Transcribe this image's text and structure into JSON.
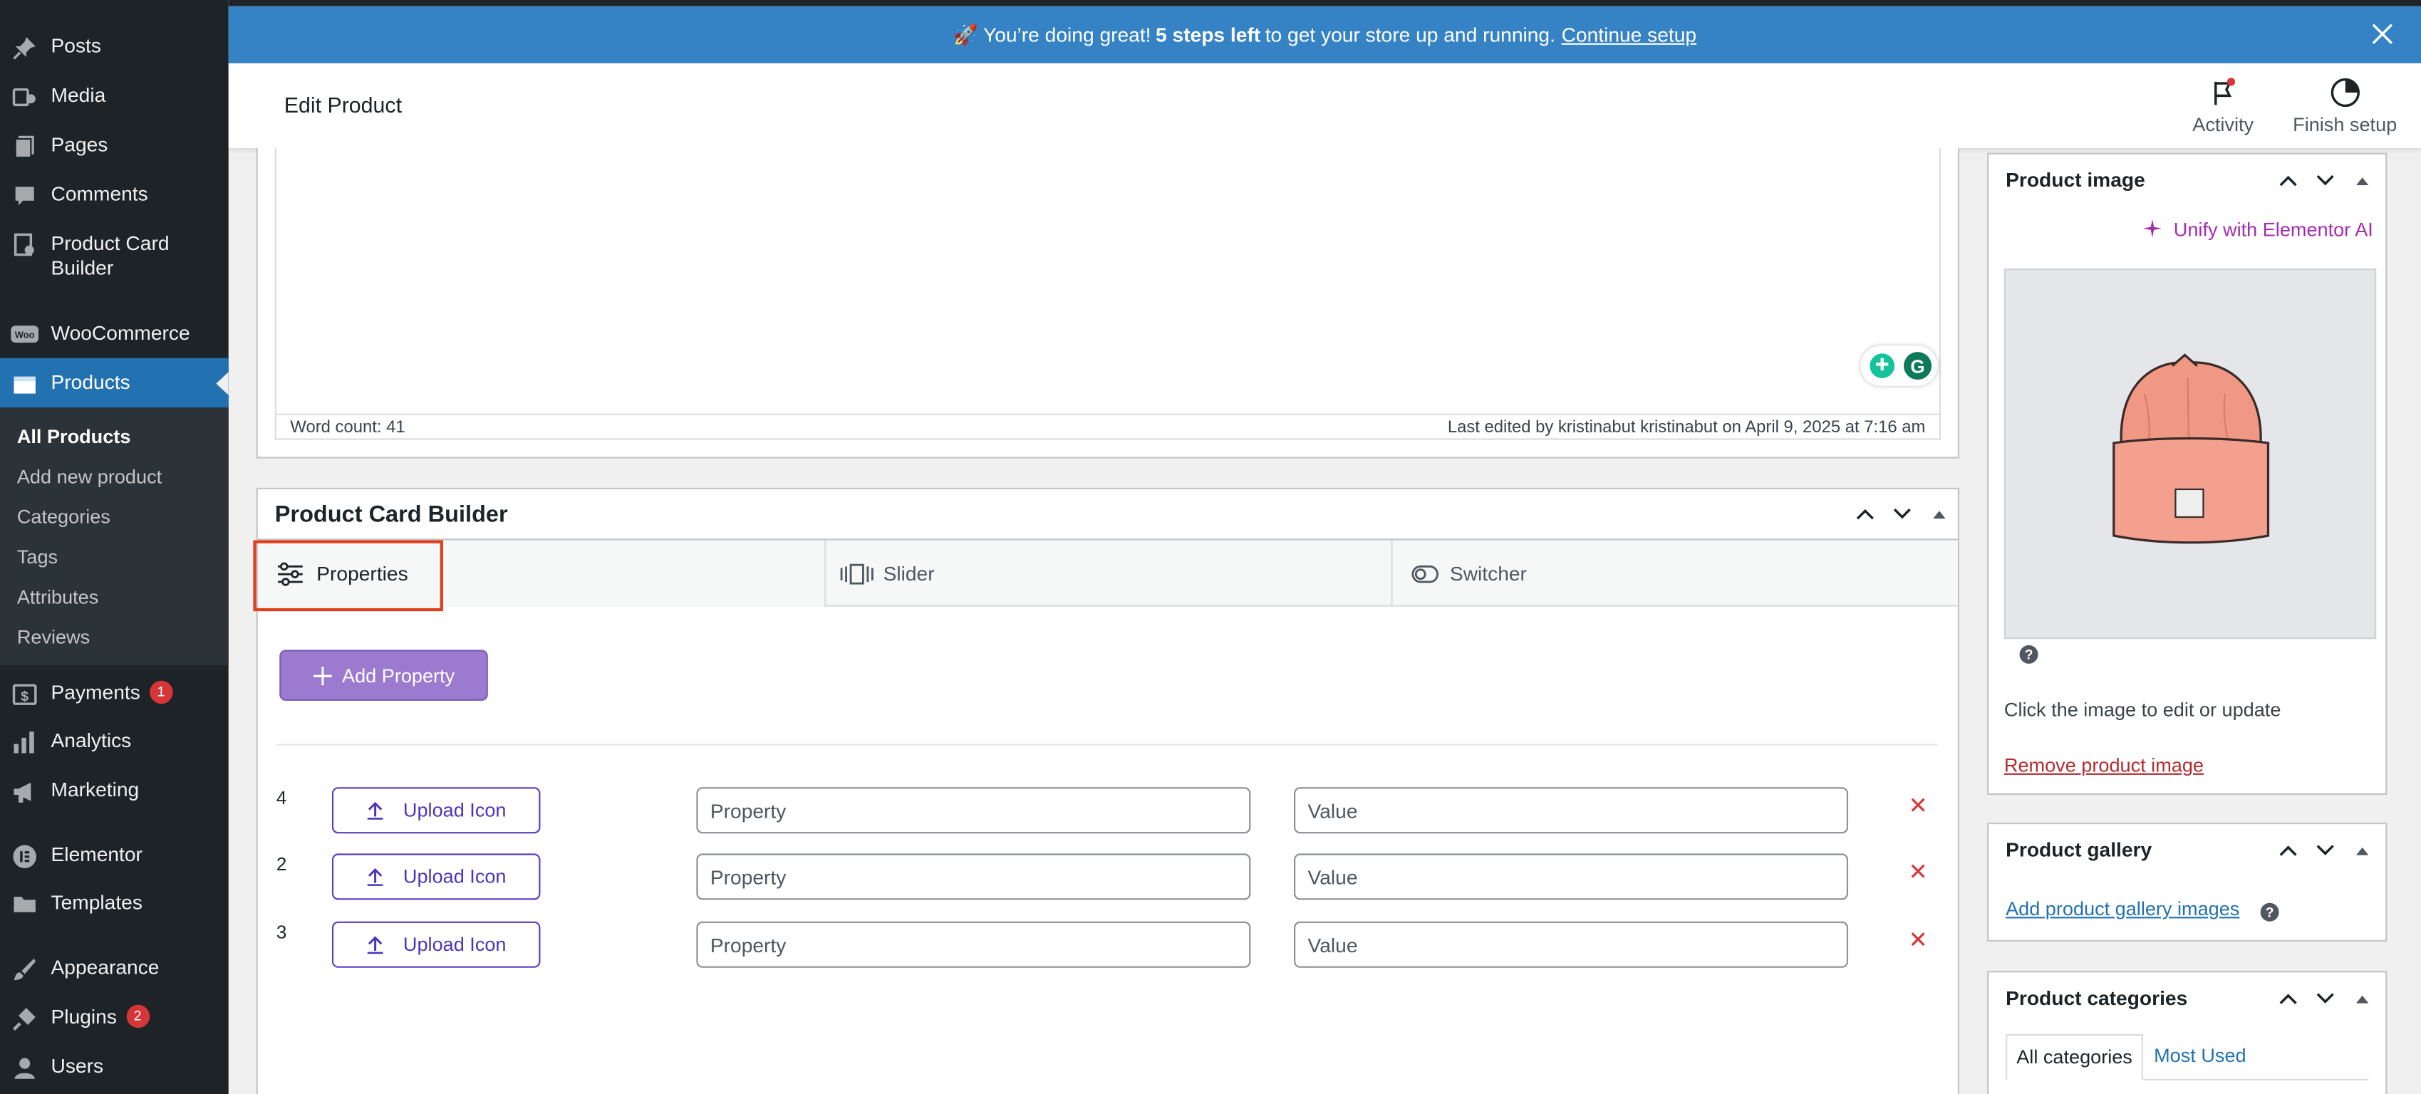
{
  "colors": {
    "sidebar_bg": "#1d2327",
    "active_menu": "#2271b1",
    "banner": "#3582c4",
    "add_property_button": "#9b7ad0",
    "highlight_border": "#e2401c",
    "delete_red": "#d63638",
    "elementor_ai": "#a42cae"
  },
  "sidebar": {
    "items": [
      {
        "label": "Posts",
        "icon": "pushpin-icon"
      },
      {
        "label": "Media",
        "icon": "media-icon"
      },
      {
        "label": "Pages",
        "icon": "pages-icon"
      },
      {
        "label": "Comments",
        "icon": "comments-icon"
      },
      {
        "label": "Product Card Builder",
        "icon": "product-card-icon"
      },
      {
        "label": "WooCommerce",
        "icon": "woo-icon"
      },
      {
        "label": "Products",
        "icon": "products-icon"
      },
      {
        "label": "Payments",
        "icon": "payments-icon",
        "badge": "1"
      },
      {
        "label": "Analytics",
        "icon": "analytics-icon"
      },
      {
        "label": "Marketing",
        "icon": "megaphone-icon"
      },
      {
        "label": "Elementor",
        "icon": "elementor-icon"
      },
      {
        "label": "Templates",
        "icon": "folder-icon"
      },
      {
        "label": "Appearance",
        "icon": "paintbrush-icon"
      },
      {
        "label": "Plugins",
        "icon": "plugin-icon",
        "badge": "2"
      },
      {
        "label": "Users",
        "icon": "user-icon"
      }
    ],
    "submenu": [
      "All Products",
      "Add new product",
      "Categories",
      "Tags",
      "Attributes",
      "Reviews"
    ]
  },
  "banner": {
    "prefix": "🚀 You’re doing great!",
    "bold": "5 steps left",
    "middle": "to get your store up and running.",
    "link": "Continue setup"
  },
  "header": {
    "title": "Edit Product",
    "activity": "Activity",
    "finish_setup": "Finish setup"
  },
  "editor": {
    "word_count": "Word count: 41",
    "last_edited": "Last edited by kristinabut kristinabut on April 9, 2025 at 7:16 am"
  },
  "product_card_builder": {
    "title": "Product Card Builder",
    "tabs": [
      "Properties",
      "Slider",
      "Switcher"
    ],
    "add_property": "Add Property",
    "rows": [
      {
        "num": "4",
        "upload": "Upload Icon",
        "property_placeholder": "Property",
        "value_placeholder": "Value"
      },
      {
        "num": "2",
        "upload": "Upload Icon",
        "property_placeholder": "Property",
        "value_placeholder": "Value"
      },
      {
        "num": "3",
        "upload": "Upload Icon",
        "property_placeholder": "Property",
        "value_placeholder": "Value"
      }
    ]
  },
  "product_image": {
    "title": "Product image",
    "unify": "Unify with Elementor AI",
    "click_text": "Click the image to edit or update",
    "remove": "Remove product image"
  },
  "product_gallery": {
    "title": "Product gallery",
    "add": "Add product gallery images"
  },
  "product_categories": {
    "title": "Product categories",
    "tab_all": "All categories",
    "tab_most": "Most Used"
  }
}
